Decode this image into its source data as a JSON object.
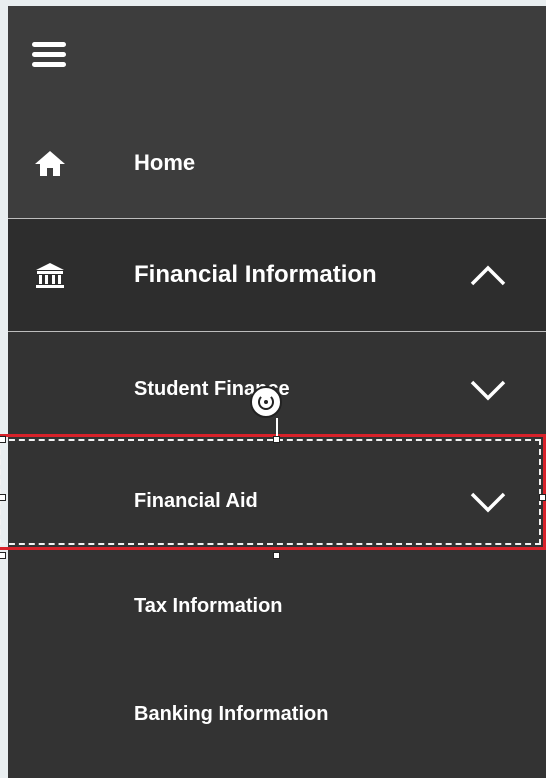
{
  "nav": {
    "menu_icon": "hamburger-menu-icon",
    "items": [
      {
        "label": "Home",
        "icon": "home-icon"
      },
      {
        "label": "Financial Information",
        "icon": "bank-icon",
        "expanded": true
      }
    ],
    "subitems": [
      {
        "label": "Student Finance",
        "chevron": "chevron-down-icon"
      },
      {
        "label": "Financial Aid",
        "chevron": "chevron-down-icon",
        "selected": true
      },
      {
        "label": "Tax Information"
      },
      {
        "label": "Banking Information"
      }
    ]
  },
  "colors": {
    "nav_background": "#333333",
    "nav_top_background": "#3d3d3d",
    "expanded_background": "#2d2d2d",
    "selection_border": "#d8222a",
    "text": "#ffffff"
  }
}
